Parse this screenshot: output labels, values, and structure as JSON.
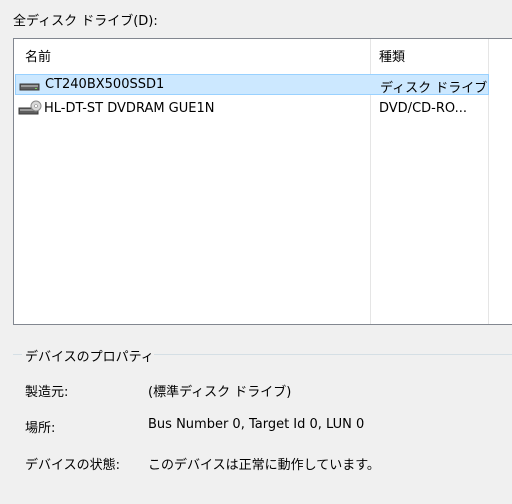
{
  "section_label": "全ディスク ドライブ(D):",
  "list": {
    "columns": [
      {
        "label": "名前"
      },
      {
        "label": "種類"
      }
    ],
    "rows": [
      {
        "name": "CT240BX500SSD1",
        "type": "ディスク ドライブ",
        "icon": "hard-drive-icon",
        "selected": true
      },
      {
        "name": "HL-DT-ST DVDRAM GUE1N",
        "type": "DVD/CD-RO...",
        "icon": "optical-drive-icon",
        "selected": false
      }
    ]
  },
  "properties": {
    "group_title": "デバイスのプロパティ",
    "manufacturer_label": "製造元:",
    "manufacturer_value": "(標準ディスク ドライブ)",
    "location_label": "場所:",
    "location_value": "Bus Number 0, Target Id 0, LUN 0",
    "status_label": "デバイスの状態:",
    "status_value": "このデバイスは正常に動作しています。"
  },
  "colors": {
    "selection_bg": "#cce8ff",
    "selection_border": "#99d1ff",
    "window_bg": "#f0f0f0"
  }
}
